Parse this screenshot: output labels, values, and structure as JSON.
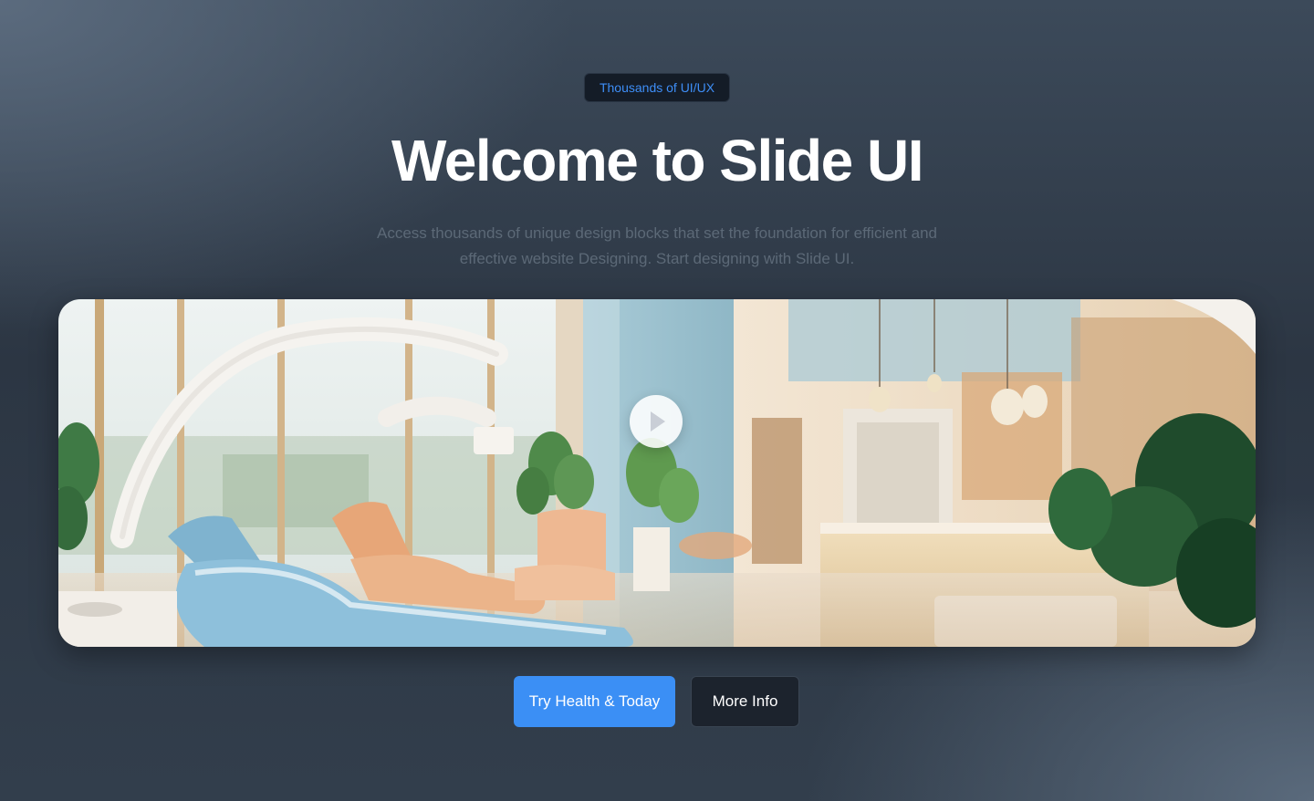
{
  "hero": {
    "badge": "Thousands of UI/UX",
    "title": "Welcome to Slide UI",
    "subtitle": "Access thousands of unique design blocks that set the foundation for efficient and effective website Designing. Start designing with Slide UI."
  },
  "media": {
    "play_icon": "play-icon"
  },
  "actions": {
    "primary_label": "Try Health & Today",
    "secondary_label": "More Info"
  },
  "colors": {
    "accent": "#3b8ff5",
    "badge_text": "#3e8ef7",
    "secondary_button_bg": "#1c232d"
  }
}
